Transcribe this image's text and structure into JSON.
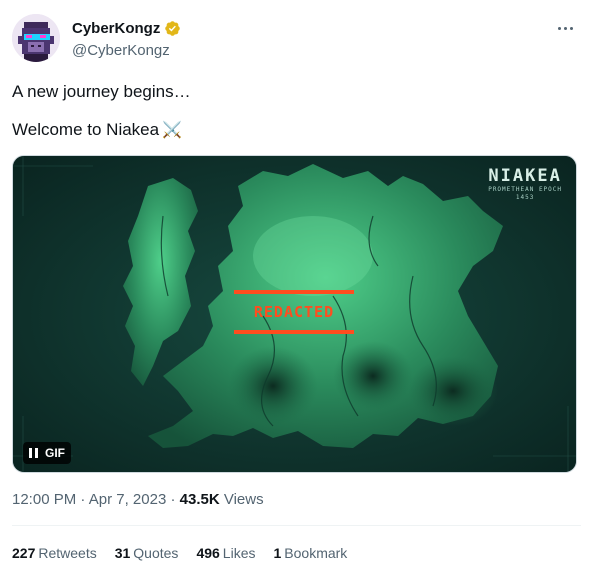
{
  "author": {
    "display_name": "CyberKongz",
    "handle": "@CyberKongz",
    "verified_color": "#e2b719"
  },
  "tweet": {
    "line1": "A new journey begins…",
    "line2": "Welcome to Niakea",
    "line2_emoji": "⚔️"
  },
  "media": {
    "map_title": "NIAKEA",
    "map_subtitle": "PROMETHEAN EPOCH",
    "map_subtitle_year": "1453",
    "redacted_label": "REDACTED",
    "gif_label": "GIF",
    "accent_color": "#ff4d1f"
  },
  "meta": {
    "time": "12:00 PM",
    "separator": "·",
    "date": "Apr 7, 2023",
    "views_count": "43.5K",
    "views_label": "Views"
  },
  "stats": {
    "retweets_count": "227",
    "retweets_label": "Retweets",
    "quotes_count": "31",
    "quotes_label": "Quotes",
    "likes_count": "496",
    "likes_label": "Likes",
    "bookmarks_count": "1",
    "bookmarks_label": "Bookmark"
  }
}
